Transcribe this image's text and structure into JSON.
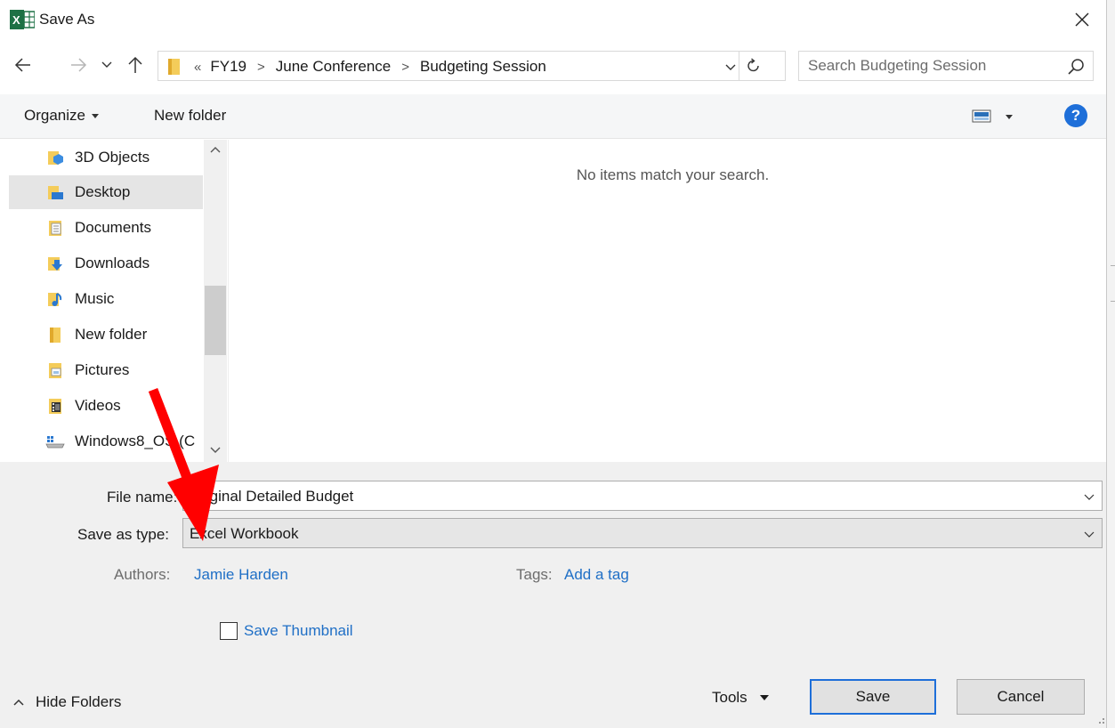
{
  "window": {
    "title": "Save As",
    "app_icon": "excel-icon"
  },
  "address": {
    "overflow": "«",
    "crumbs": [
      "FY19",
      "June Conference",
      "Budgeting Session"
    ],
    "separator": ">"
  },
  "search": {
    "placeholder": "Search Budgeting Session"
  },
  "commands": {
    "organize": "Organize",
    "new_folder": "New folder",
    "help": "?"
  },
  "nav_pane": {
    "items": [
      {
        "label": "3D Objects",
        "icon": "3d-objects-icon"
      },
      {
        "label": "Desktop",
        "icon": "desktop-icon",
        "selected": true
      },
      {
        "label": "Documents",
        "icon": "documents-icon"
      },
      {
        "label": "Downloads",
        "icon": "downloads-icon"
      },
      {
        "label": "Music",
        "icon": "music-icon"
      },
      {
        "label": "New folder",
        "icon": "folder-icon"
      },
      {
        "label": "Pictures",
        "icon": "pictures-icon"
      },
      {
        "label": "Videos",
        "icon": "videos-icon"
      },
      {
        "label": "Windows8_OS (C",
        "icon": "drive-icon"
      }
    ]
  },
  "content": {
    "empty_message": "No items match your search."
  },
  "form": {
    "file_name_label": "File name:",
    "file_name_value": "Original Detailed Budget",
    "save_type_label": "Save as type:",
    "save_type_value": "Excel Workbook",
    "authors_label": "Authors:",
    "authors_value": "Jamie Harden",
    "tags_label": "Tags:",
    "tags_value": "Add a tag",
    "thumbnail_label": "Save Thumbnail",
    "thumbnail_checked": false
  },
  "footer": {
    "hide_folders": "Hide Folders",
    "tools": "Tools",
    "save": "Save",
    "cancel": "Cancel"
  },
  "colors": {
    "accent": "#1e6fd9",
    "link": "#1f6fc6",
    "annotation_arrow": "#ff0000",
    "excel_green": "#1e7145"
  }
}
